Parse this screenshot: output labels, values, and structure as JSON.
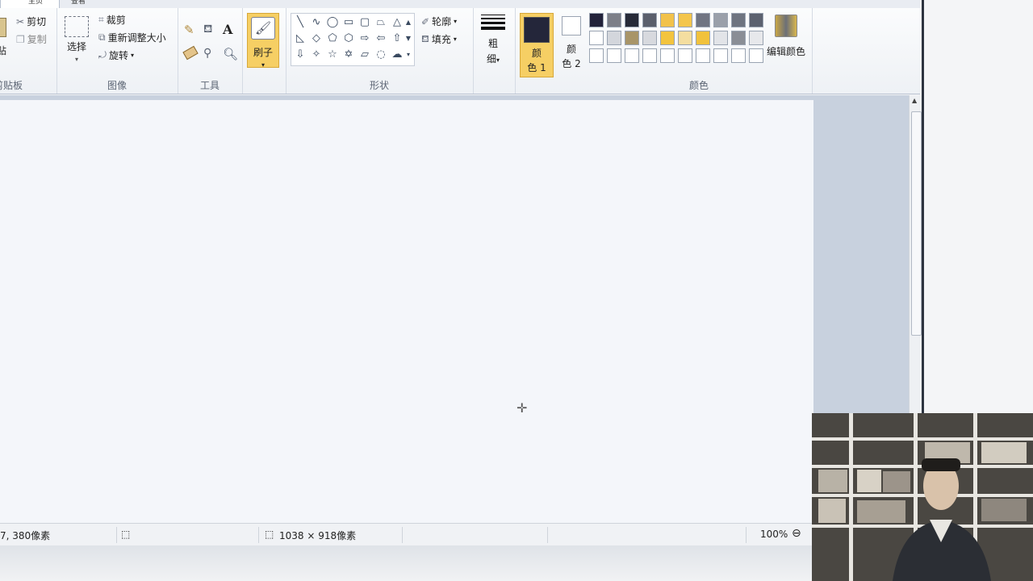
{
  "tabs": {
    "home": "主页",
    "view": "查看"
  },
  "clipboard": {
    "paste": "粘贴",
    "cut": "剪切",
    "copy": "复制",
    "label": "剪贴板"
  },
  "image": {
    "select": "选择",
    "crop": "裁剪",
    "resize": "重新调整大小",
    "rotate": "旋转",
    "label": "图像"
  },
  "tools": {
    "label": "工具"
  },
  "brush": {
    "label": "刷子"
  },
  "shapes": {
    "outline": "轮廓",
    "fill": "填充",
    "label": "形状"
  },
  "size": {
    "label_top": "粗",
    "label_bottom": "细"
  },
  "color1": {
    "label_top": "颜",
    "label_bottom": "色 1",
    "value": "#24263a"
  },
  "color2": {
    "label_top": "颜",
    "label_bottom": "色 2",
    "value": "#ffffff"
  },
  "colors": {
    "label": "颜色",
    "edit": "编辑颜色",
    "row1": [
      "#22223a",
      "#7c7f88",
      "#262a38",
      "#5a5f6c",
      "#f2c24a",
      "#f4c64c",
      "#707582",
      "#9aa0aa",
      "#6e7480",
      "#5c6270"
    ],
    "row2": [
      "#ffffff",
      "#d3d6dc",
      "#a89568",
      "#d7d9de",
      "#f3c43e",
      "#f4dea0",
      "#f1c23c",
      "#e2e4e8",
      "#8a8e96",
      "#e7e8eb"
    ],
    "row3": [
      "#ffffff",
      "#ffffff",
      "#ffffff",
      "#ffffff",
      "#ffffff",
      "#ffffff",
      "#ffffff",
      "#ffffff",
      "#ffffff",
      "#ffffff"
    ]
  },
  "status": {
    "cursor_pos": "7, 380像素",
    "canvas_size": "1038 × 918像素",
    "zoom": "100%"
  }
}
